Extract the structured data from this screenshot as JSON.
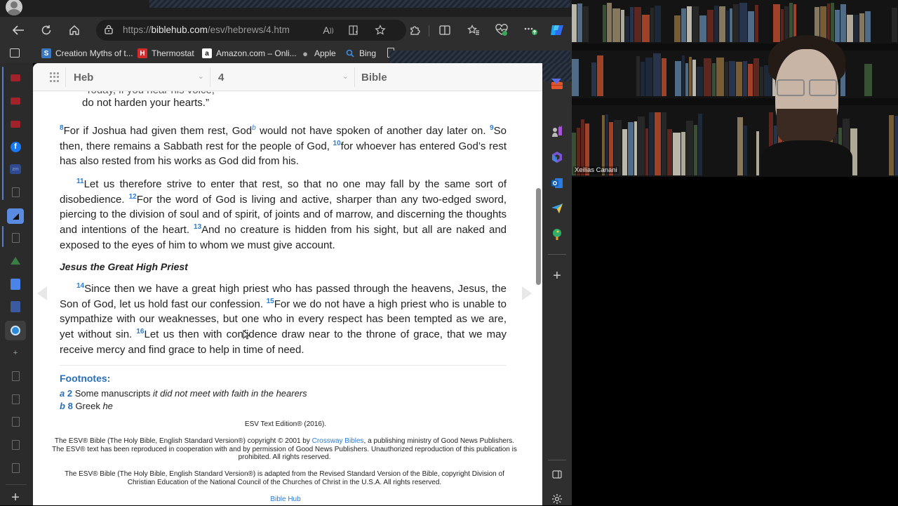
{
  "browser": {
    "url_prefix": "https://",
    "url_domain": "biblehub.com",
    "url_path": "/esv/hebrews/4.htm",
    "bookmarks": [
      {
        "label": "Creation Myths of t...",
        "icon": "cs-favicon"
      },
      {
        "label": "Thermostat",
        "icon": "h-favicon"
      },
      {
        "label": "Amazon.com – Onli...",
        "icon": "amazon-favicon"
      },
      {
        "label": "Apple",
        "icon": "apple-icon"
      },
      {
        "label": "Bing",
        "icon": "search-icon"
      }
    ]
  },
  "toolbar": {
    "book_select": "Heb",
    "chapter_select": "4",
    "version_select": "Bible"
  },
  "passage": {
    "partial_line": "“Today, if you hear his voice,",
    "line_cont": "do not harden your hearts.”",
    "v8_num": "8",
    "v8": "For if Joshua had given them rest, God",
    "fn_b": "b",
    "v8b": " would not have spoken of another day later on.",
    "v9_num": "9",
    "v9": "So then, there remains a Sabbath rest for the people of God, ",
    "v10_num": "10",
    "v10": "for whoever has entered God’s rest has also rested from his works as God did from his.",
    "v11_num": "11",
    "v11": "Let us therefore strive to enter that rest, so that no one may fall by the same sort of disobedience. ",
    "v12_num": "12",
    "v12": "For the word of God is living and active, sharper than any two-edged sword, piercing to the division of soul and of spirit, of joints and of marrow, and discerning the thoughts and intentions of the heart. ",
    "v13_num": "13",
    "v13": "And no creature is hidden from his sight, but all are naked and exposed to the eyes of him to whom we must give account.",
    "heading": "Jesus the Great High Priest",
    "v14_num": "14",
    "v14": "Since then we have a great high priest who has passed through the heavens, Jesus, the Son of God, let us hold fast our confession. ",
    "v15_num": "15",
    "v15": "For we do not have a high priest who is unable to sympathize with our weaknesses, but one who in every respect has been tempted as we are, yet without sin. ",
    "v16_num": "16",
    "v16": "Let us then with confidence draw near to the throne of grace, that we may receive mercy and find grace to help in time of need."
  },
  "footnotes": {
    "title": "Footnotes:",
    "items": [
      {
        "letter": "a",
        "verse": "2",
        "text": "Some manuscripts ",
        "italic": "it did not meet with faith in the hearers"
      },
      {
        "letter": "b",
        "verse": "8",
        "text": "Greek ",
        "italic": "he"
      }
    ]
  },
  "copyright": {
    "edition": "ESV Text Edition® (2016).",
    "p1a": "The ESV® Bible (The Holy Bible, English Standard Version®) copyright © 2001 by ",
    "p1link": "Crossway Bibles",
    "p1b": ", a publishing ministry of Good News Publishers. The ESV® text has been reproduced in cooperation with and by permission of Good News Publishers. Unauthorized reproduction of this publication is prohibited. All rights reserved.",
    "p2": "The ESV® Bible (The Holy Bible, English Standard Version®) is adapted from the Revised Standard Version of the Bible, copyright Division of Christian Education of the National Council of the Churches of Christ in the U.S.A. All rights reserved.",
    "site_link": "Bible Hub"
  },
  "video": {
    "participant_name": "Xeilias Canani"
  },
  "colors": {
    "accent": "#2b7bd3",
    "footnote_blue": "#2a6fb5"
  }
}
